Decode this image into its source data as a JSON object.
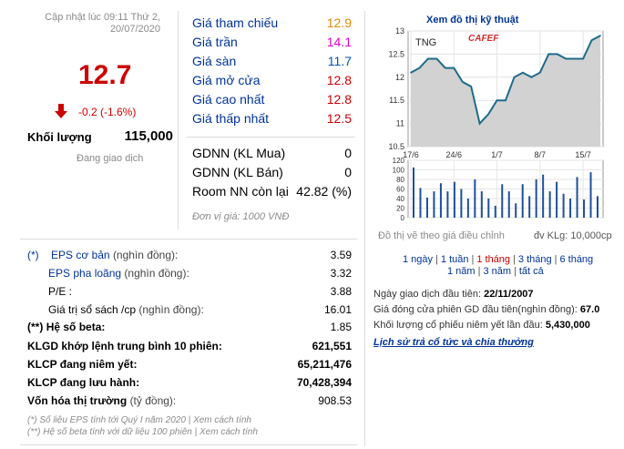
{
  "updated": {
    "line1": "Cập nhật lúc 09:11 Thứ 2,",
    "line2": "20/07/2020"
  },
  "price": "12.7",
  "change": "-0.2 (-1.6%)",
  "volume": {
    "label": "Khối lượng",
    "value": "115,000"
  },
  "trading_status": "Đang giao dịch",
  "price_table": [
    {
      "label": "Giá tham chiếu",
      "value": "12.9"
    },
    {
      "label": "Giá trần",
      "value": "14.1"
    },
    {
      "label": "Giá sàn",
      "value": "11.7"
    },
    {
      "label": "Giá mở cửa",
      "value": "12.8"
    },
    {
      "label": "Giá cao nhất",
      "value": "12.8"
    },
    {
      "label": "Giá thấp nhất",
      "value": "12.5"
    }
  ],
  "foreign_table": [
    {
      "label": "GDNN (KL Mua)",
      "value": "0"
    },
    {
      "label": "GDNN (KL Bán)",
      "value": "0"
    },
    {
      "label": "Room NN còn lại",
      "value": "42.82 (%)"
    }
  ],
  "unit_note": "Đơn vị giá: 1000 VNĐ",
  "stats": [
    {
      "prefix": "(*)",
      "label": "EPS cơ bản",
      "suffix": "(nghìn đồng):",
      "value": "3.59"
    },
    {
      "prefix": "",
      "label": "EPS pha loãng",
      "suffix": "(nghìn đồng):",
      "value": "3.32"
    },
    {
      "prefix": "",
      "label": "P/E :",
      "suffix": "",
      "value": "3.88"
    },
    {
      "prefix": "",
      "label": "Giá trị sổ sách /cp",
      "suffix": "(nghìn đồng):",
      "value": "16.01"
    },
    {
      "prefix": "(**)",
      "label": "Hệ số beta:",
      "suffix": "",
      "value": "1.85"
    },
    {
      "prefix": "",
      "label": "KLGD khớp lệnh trung bình 10 phiên:",
      "suffix": "",
      "value": "621,551"
    },
    {
      "prefix": "",
      "label": "KLCP đang niêm yết:",
      "suffix": "",
      "value": "65,211,476"
    },
    {
      "prefix": "",
      "label": "KLCP đang lưu hành:",
      "suffix": "",
      "value": "70,428,394"
    },
    {
      "prefix": "",
      "label": "Vốn hóa thị trường",
      "suffix": "(tỷ đồng):",
      "value": "908.53"
    }
  ],
  "footnotes": {
    "line1_text": "(*) Số liệu EPS tính tới Quý I năm 2020 | ",
    "line1_link": "Xem cách tính",
    "line2_text": "(**) Hệ số beta tính với dữ liệu 100 phiên | ",
    "line2_link": "Xem cách tính"
  },
  "chart": {
    "title": "Xem đồ thị kỹ thuật",
    "ticker": "TNG",
    "brand": "CAFEF",
    "note_left": "Đồ thị vẽ theo giá điều chỉnh",
    "note_right": "đv KLg: 10,000cp",
    "colors": {
      "line": "#1e6b8a",
      "area": "#d2d2d2",
      "volume": "#1e4f9c",
      "brand": "#d62b2b"
    }
  },
  "chart_data": {
    "type": "line",
    "x_tick_labels": [
      "17/6",
      "24/6",
      "1/7",
      "8/7",
      "15/7"
    ],
    "price": {
      "ylim": [
        10.5,
        13
      ],
      "y_ticks": [
        "13",
        "12.5",
        "12",
        "11.5",
        "11",
        "10.5"
      ],
      "values": [
        12.1,
        12.2,
        12.4,
        12.4,
        12.2,
        12.2,
        11.9,
        11.8,
        11.0,
        11.2,
        11.5,
        11.5,
        12.0,
        12.1,
        12.0,
        12.1,
        12.5,
        12.5,
        12.4,
        12.4,
        12.4,
        12.8,
        12.9
      ]
    },
    "volume": {
      "ylim": [
        0,
        120
      ],
      "y_ticks": [
        "120",
        "100",
        "80",
        "60",
        "40",
        "20",
        "0"
      ],
      "values": [
        105,
        62,
        42,
        55,
        72,
        55,
        75,
        60,
        40,
        80,
        55,
        40,
        25,
        70,
        55,
        30,
        70,
        45,
        80,
        90,
        55,
        75,
        50,
        40,
        85,
        38,
        95,
        45
      ]
    }
  },
  "ranges": {
    "row1": [
      "1 ngày",
      "1 tuần",
      "1 tháng",
      "3 tháng",
      "6 tháng"
    ],
    "row2": [
      "1 năm",
      "3 năm",
      "tất cả"
    ],
    "active": "1 tháng"
  },
  "info": [
    {
      "label": "Ngày giao dịch đầu tiên:",
      "value": "22/11/2007"
    },
    {
      "label": "Giá đóng cửa phiên GD đầu tiên(nghìn đồng):",
      "value": "67.0"
    },
    {
      "label": "Khối lượng cổ phiếu niêm yết lần đầu:",
      "value": "5,430,000"
    }
  ],
  "history_link": "Lịch sử trả cổ tức và chia thưởng"
}
